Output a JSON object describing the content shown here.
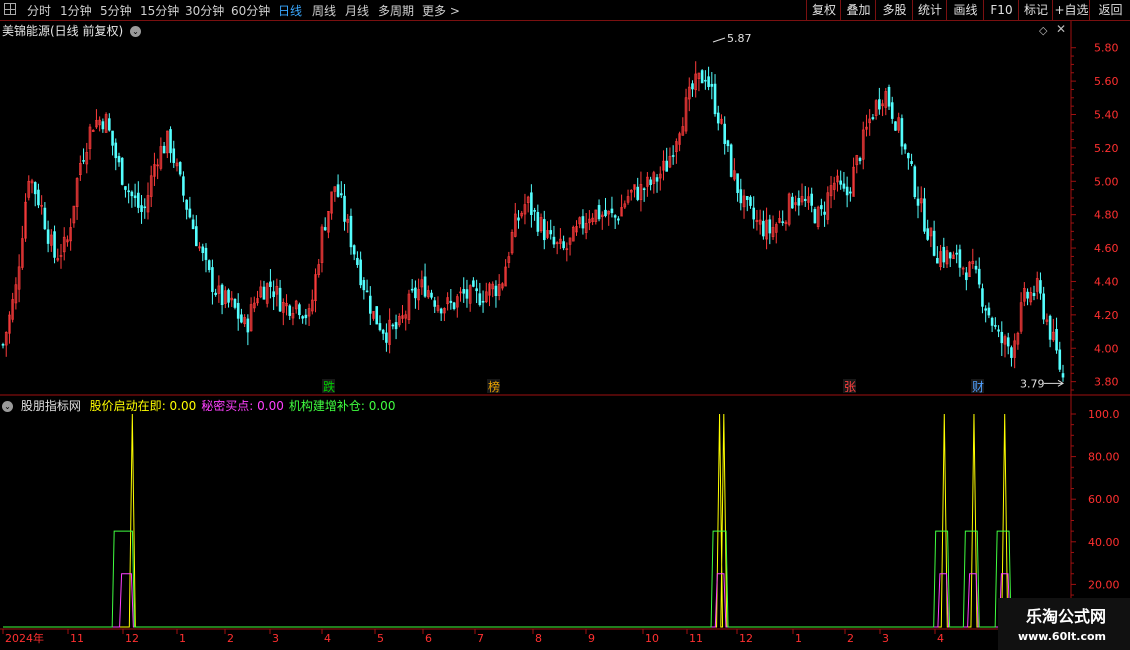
{
  "toolbar": {
    "periods": [
      {
        "label": "分时",
        "active": false
      },
      {
        "label": "1分钟",
        "active": false
      },
      {
        "label": "5分钟",
        "active": false
      },
      {
        "label": "15分钟",
        "active": false
      },
      {
        "label": "30分钟",
        "active": false
      },
      {
        "label": "60分钟",
        "active": false
      },
      {
        "label": "日线",
        "active": true
      },
      {
        "label": "周线",
        "active": false
      },
      {
        "label": "月线",
        "active": false
      },
      {
        "label": "多周期",
        "active": false
      },
      {
        "label": "更多 >",
        "active": false
      }
    ],
    "right_buttons": [
      "复权",
      "叠加",
      "多股",
      "统计",
      "画线",
      "F10",
      "标记",
      "+自选",
      "返回"
    ]
  },
  "main_chart": {
    "title": "美锦能源(日线 前复权)",
    "y_ticks": [
      "5.80",
      "5.60",
      "5.40",
      "5.20",
      "5.00",
      "4.80",
      "4.60",
      "4.40",
      "4.20",
      "4.00",
      "3.80"
    ],
    "high_label": "5.87",
    "low_label": "3.79",
    "badges": [
      {
        "text": "跌",
        "color": "#00d000"
      },
      {
        "text": "榜",
        "color": "#e8a000"
      },
      {
        "text": "张",
        "color": "#ff4040"
      },
      {
        "text": "财",
        "color": "#50a0ff"
      }
    ]
  },
  "indicator": {
    "name": "股朋指标网",
    "series": [
      {
        "name": "股价启动在即",
        "value": "0.00",
        "color": "#ffff00"
      },
      {
        "name": "秘密买点",
        "value": "0.00",
        "color": "#ff40ff"
      },
      {
        "name": "机构建增补仓",
        "value": "0.00",
        "color": "#40ff40"
      }
    ],
    "y_ticks": [
      "100.0",
      "80.00",
      "60.00",
      "40.00",
      "20.00"
    ]
  },
  "x_axis": {
    "labels": [
      "2024年",
      "11",
      "12",
      "1",
      "2",
      "3",
      "4",
      "5",
      "6",
      "7",
      "8",
      "9",
      "10",
      "11",
      "12",
      "1",
      "2",
      "3",
      "4"
    ]
  },
  "watermark": {
    "title": "乐淘公式网",
    "url": "www.60lt.com"
  },
  "colors": {
    "up": "#ff3c3c",
    "down": "#54ffff",
    "frame": "#a01010"
  },
  "chart_data": [
    {
      "type": "candlestick",
      "title": "美锦能源(日线 前复权)",
      "y_range": [
        3.72,
        5.96
      ],
      "y_ticks": [
        5.8,
        5.6,
        5.4,
        5.2,
        5.0,
        4.8,
        4.6,
        4.4,
        4.2,
        4.0,
        3.8
      ],
      "annotations": [
        {
          "text": "5.87",
          "value": 5.87
        },
        {
          "text": "3.79",
          "value": 3.79
        }
      ],
      "close_trend": [
        4.02,
        4.35,
        5.05,
        4.85,
        4.55,
        4.62,
        5.1,
        5.35,
        5.38,
        5.1,
        4.92,
        4.8,
        5.15,
        5.25,
        4.95,
        4.7,
        4.45,
        4.3,
        4.25,
        4.12,
        4.35,
        4.38,
        4.25,
        4.28,
        4.18,
        4.7,
        4.98,
        4.72,
        4.45,
        4.2,
        4.1,
        4.12,
        4.3,
        4.38,
        4.28,
        4.25,
        4.32,
        4.3,
        4.35,
        4.38,
        4.72,
        4.88,
        4.75,
        4.62,
        4.58,
        4.7,
        4.82,
        4.8,
        4.78,
        4.92,
        4.95,
        5.0,
        5.1,
        5.35,
        5.55,
        5.65,
        5.4,
        5.08,
        4.85,
        4.75,
        4.7,
        4.78,
        4.92,
        4.85,
        4.78,
        5.0,
        4.9,
        5.15,
        5.4,
        5.55,
        5.35,
        5.08,
        4.8,
        4.58,
        4.55,
        4.5,
        4.45,
        4.25,
        4.05,
        4.0,
        4.3,
        4.35,
        4.1,
        3.82
      ]
    },
    {
      "type": "line",
      "y_range": [
        0,
        100
      ],
      "y_ticks": [
        100,
        80,
        60,
        40,
        20
      ],
      "series": [
        {
          "name": "股价启动在即",
          "color": "#ffff00",
          "spikes": [
            {
              "at": 0.122,
              "value": 100
            },
            {
              "at": 0.676,
              "value": 100
            },
            {
              "at": 0.68,
              "value": 100
            },
            {
              "at": 0.888,
              "value": 100
            },
            {
              "at": 0.916,
              "value": 100
            },
            {
              "at": 0.945,
              "value": 100
            }
          ]
        },
        {
          "name": "秘密买点",
          "color": "#ff40ff",
          "pulses": [
            {
              "start": 0.11,
              "end": 0.123,
              "value": 25
            },
            {
              "start": 0.672,
              "end": 0.682,
              "value": 25
            },
            {
              "start": 0.882,
              "end": 0.892,
              "value": 25
            },
            {
              "start": 0.91,
              "end": 0.92,
              "value": 25
            },
            {
              "start": 0.94,
              "end": 0.95,
              "value": 25
            }
          ]
        },
        {
          "name": "机构建增补仓",
          "color": "#40ff40",
          "pulses": [
            {
              "start": 0.103,
              "end": 0.124,
              "value": 45
            },
            {
              "start": 0.668,
              "end": 0.684,
              "value": 45
            },
            {
              "start": 0.878,
              "end": 0.893,
              "value": 45
            },
            {
              "start": 0.906,
              "end": 0.921,
              "value": 45
            },
            {
              "start": 0.936,
              "end": 0.951,
              "value": 45
            }
          ]
        }
      ]
    }
  ]
}
